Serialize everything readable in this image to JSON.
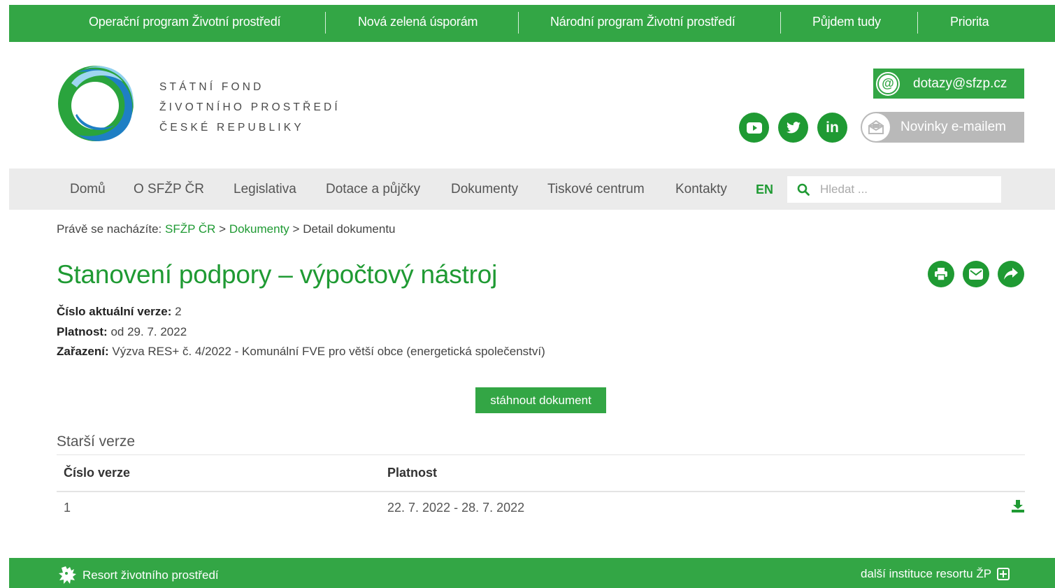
{
  "top_programs": [
    {
      "label": "Operační program Životní prostředí"
    },
    {
      "label": "Nová zelená úsporám"
    },
    {
      "label": "Národní program Životní prostředí"
    },
    {
      "label": "Půjdem tudy"
    },
    {
      "label": "Priorita"
    }
  ],
  "brand": {
    "line1": "STÁTNÍ FOND",
    "line2": "ŽIVOTNÍHO PROSTŘEDÍ",
    "line3": "ČESKÉ REPUBLIKY"
  },
  "contact": {
    "email_label": "dotazy@sfzp.cz",
    "newsletter_label": "Novinky e-mailem"
  },
  "social": [
    "youtube-icon",
    "twitter-icon",
    "linkedin-icon"
  ],
  "nav": {
    "items": [
      {
        "label": "Domů"
      },
      {
        "label": "O SFŽP ČR"
      },
      {
        "label": "Legislativa"
      },
      {
        "label": "Dotace a půjčky"
      },
      {
        "label": "Dokumenty"
      },
      {
        "label": "Tiskové centrum"
      },
      {
        "label": "Kontakty"
      }
    ],
    "lang": "EN",
    "search_placeholder": "Hledat ..."
  },
  "breadcrumb": {
    "prefix": "Právě se nacházíte:",
    "crumb1": "SFŽP ČR",
    "sep": ">",
    "crumb2": "Dokumenty",
    "current": "Detail dokumentu"
  },
  "document": {
    "title": "Stanovení podpory – výpočtový nástroj",
    "version_label": "Číslo aktuální verze:",
    "version_value": "2",
    "validity_label": "Platnost:",
    "validity_value": "od 29. 7. 2022",
    "category_label": "Zařazení:",
    "category_value": "Výzva RES+ č. 4/2022 - Komunální FVE pro větší obce (energetická společenství)",
    "download_label": "stáhnout dokument"
  },
  "older_versions": {
    "title": "Starší verze",
    "columns": [
      "Číslo verze",
      "Platnost"
    ],
    "rows": [
      {
        "version": "1",
        "validity": "22. 7. 2022 - 28. 7. 2022"
      }
    ]
  },
  "footer": {
    "left_label": "Resort životního prostředí",
    "right_label": "další instituce resortu ŽP"
  },
  "colors": {
    "brand_green": "#33a645",
    "dark_green": "#1f9a33",
    "nav_bg": "#ebebeb"
  }
}
